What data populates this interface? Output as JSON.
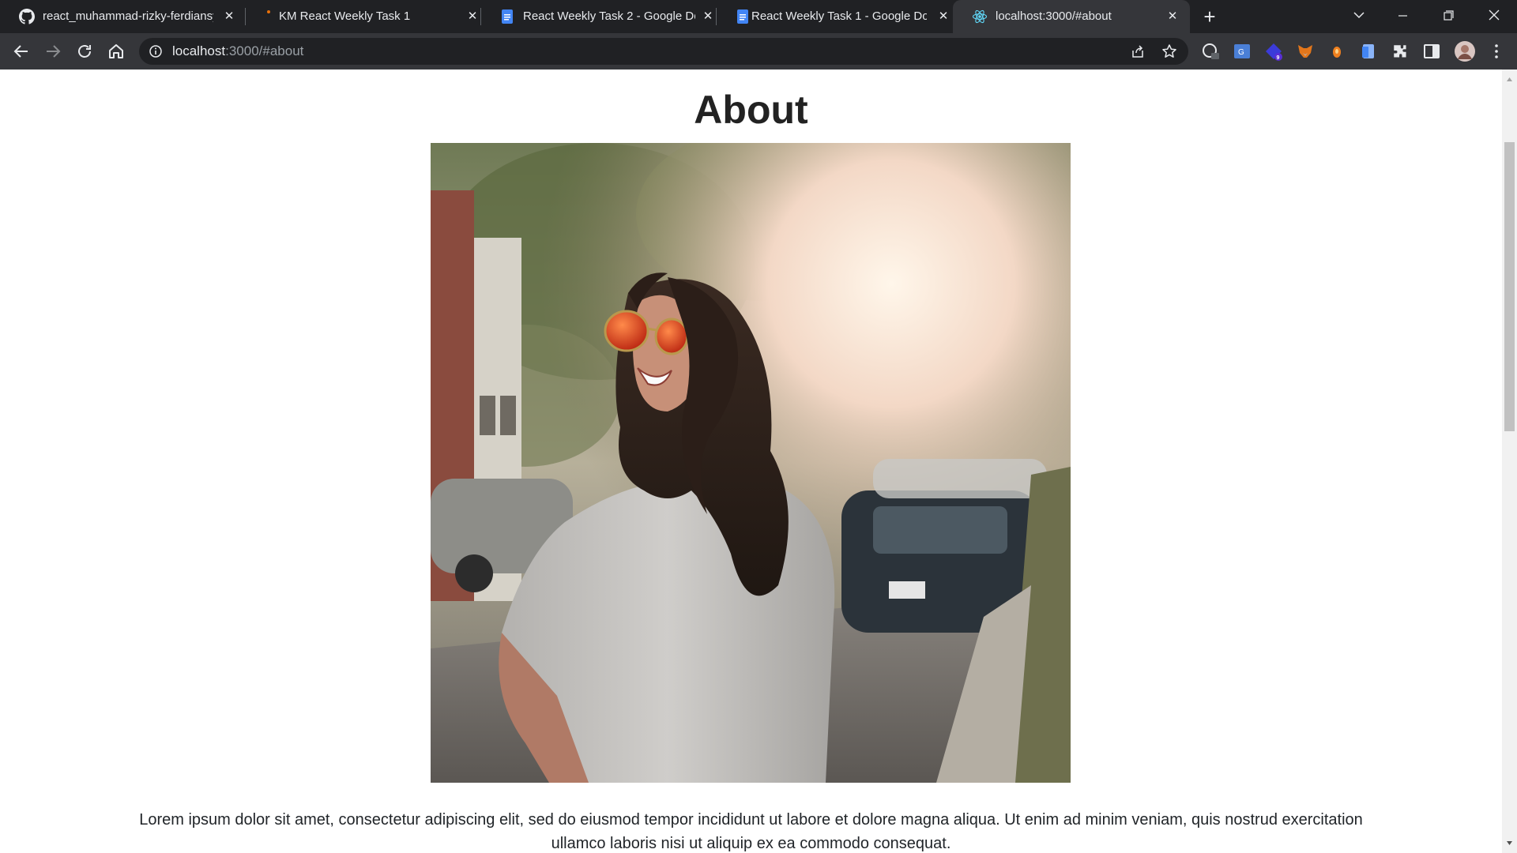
{
  "browser": {
    "tabs": [
      {
        "title": "react_muhammad-rizky-ferdiansy",
        "icon": "github-icon"
      },
      {
        "title": "KM React Weekly Task 1",
        "icon": "unsaved-dot-icon"
      },
      {
        "title": "React Weekly Task 2 - Google Do",
        "icon": "google-docs-icon"
      },
      {
        "title": "React Weekly Task 1 - Google Do",
        "icon": "google-docs-icon"
      },
      {
        "title": "localhost:3000/#about",
        "icon": "react-icon",
        "active": true
      }
    ],
    "address": {
      "host": "localhost",
      "path": ":3000/#about"
    },
    "extension_badge": "9",
    "colors": {
      "tabstrip": "#202124",
      "toolbar": "#35363a",
      "text": "#e8eaed"
    }
  },
  "page": {
    "title": "About",
    "image_alt": "Smiling woman with red sunglasses on a sunny street",
    "paragraph": "Lorem ipsum dolor sit amet, consectetur adipiscing elit, sed do eiusmod tempor incididunt ut labore et dolore magna aliqua. Ut enim ad minim veniam, quis nostrud exercitation ullamco laboris nisi ut aliquip ex ea commodo consequat."
  }
}
